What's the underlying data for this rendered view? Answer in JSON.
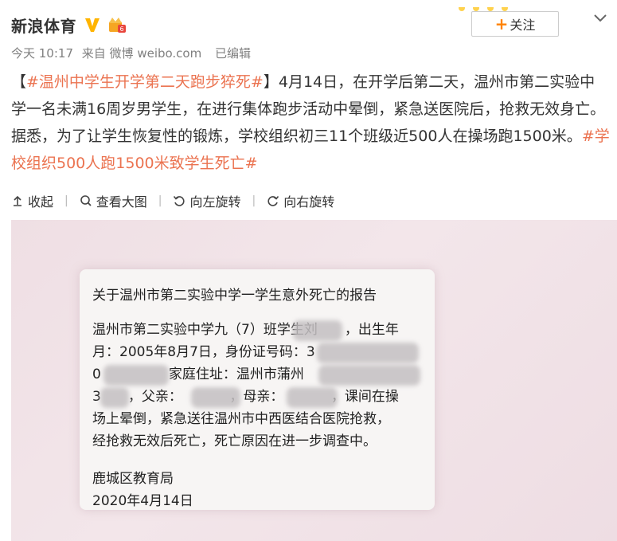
{
  "post": {
    "author": "新浪体育",
    "follow_label": "关注",
    "meta": {
      "time": "今天 10:17",
      "source": "来自 微博 weibo.com",
      "edited": "已编辑"
    },
    "text": {
      "bracket_open": "【",
      "topic1": "#温州中学生开学第二天跑步猝死#",
      "bracket_close": "】",
      "body": "4月14日，在开学后第二天，温州市第二实验中学一名未满16周岁男学生，在进行集体跑步活动中晕倒，紧急送医院后，抢救无效身亡。据悉，为了让学生恢复性的锻炼，学校组织初三11个班级近500人在操场跑1500米。",
      "topic2": "#学校组织500人跑1500米致学生死亡#"
    }
  },
  "toolbar": {
    "collapse": "收起",
    "view_large": "查看大图",
    "rotate_left": "向左旋转",
    "rotate_right": "向右旋转"
  },
  "document": {
    "title": "关于温州市第二实验中学一学生意外死亡的报告",
    "lines": [
      "温州市第二实验中学九（7）班学生刘　　，出生年",
      "月：2005年8月7日，身份证号码：3",
      "0　　　　　家庭住址：温州市蒲州",
      "3　　，父亲：　　　　，母亲：　　　　，课间在操",
      "场上晕倒，紧急送往温州市中西医结合医院抢救，",
      "经抢救无效后死亡，死亡原因在进一步调查中。"
    ],
    "issuer": "鹿城区教育局",
    "date": "2020年4月14日"
  },
  "colors": {
    "topic": "#eb7350",
    "verified": "#ffb400",
    "follow_plus": "#ff8200",
    "meta": "#808080"
  }
}
